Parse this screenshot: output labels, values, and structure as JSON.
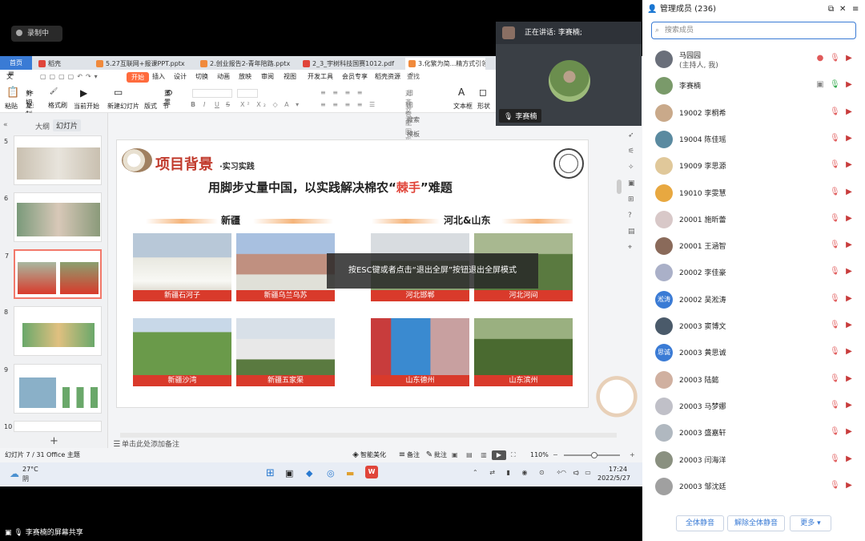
{
  "recording": {
    "label": "录制中"
  },
  "speaker": {
    "label": "正在讲话: 李赛楠;",
    "name": "李赛楠"
  },
  "wps": {
    "tabs": [
      {
        "label": "首页",
        "color": "#3a7bd5"
      },
      {
        "label": "稻壳",
        "color": "#e0453a"
      },
      {
        "label": "5.27互联网+报课PPT.pptx",
        "color": "#f08a3c"
      },
      {
        "label": "2.创业报告2-青年陪路.pptx",
        "color": "#f08a3c"
      },
      {
        "label": "2_3_宇树科技国赛1012.pdf",
        "color": "#e0453a"
      },
      {
        "label": "3.化繁为简...精方式引领者",
        "color": "#f08a3c"
      }
    ],
    "menu": [
      "文件",
      "开始",
      "插入",
      "设计",
      "切换",
      "动画",
      "放映",
      "审阅",
      "视图",
      "开发工具",
      "会员专享",
      "稻壳资源"
    ],
    "search_label": "查找命令、搜索模板",
    "ribbon": {
      "paste": "粘贴",
      "cut": "剪切",
      "copy": "复制",
      "format_painter": "格式刷",
      "from_current": "当前开始",
      "new_slide": "新建幻灯片",
      "layout": "版式",
      "section": "节",
      "reset": "重置",
      "align_text": "对齐文本",
      "convert_smartart": "转智能图形",
      "textbox": "文本框",
      "shape": "形状",
      "bold": "B",
      "italic": "I",
      "underline": "U",
      "strike": "S"
    },
    "left_tabs": [
      "大纲",
      "幻灯片"
    ],
    "thumb_numbers": [
      "5",
      "6",
      "7",
      "8",
      "9",
      "10"
    ],
    "add_slide": "+",
    "notes_placeholder": "单击此处添加备注",
    "status": {
      "slide_info": "幻灯片 7 / 31",
      "theme": "Office 主题",
      "beautify": "智能美化",
      "notes": "备注",
      "comments": "批注",
      "zoom": "110%"
    },
    "taskbar": {
      "temp": "27°C",
      "weather": "阴",
      "time": "17:24",
      "date": "2022/5/27"
    }
  },
  "slide": {
    "title": "项目背景",
    "subtitle": "·实习实践",
    "headline_pre": "用脚步丈量中国，以实践解决棉农“",
    "headline_hl": "棘手",
    "headline_post": "”难题",
    "region_left": "新疆",
    "region_right": "河北&山东",
    "photos": [
      "新疆石河子",
      "新疆乌兰乌苏",
      "河北邯郸",
      "河北河间",
      "新疆沙湾",
      "新疆五家渠",
      "山东德州",
      "山东滨州"
    ],
    "esc_message": "按ESC键或者点击“退出全屏”按钮退出全屏模式"
  },
  "members": {
    "title": "管理成员 (236)",
    "search_placeholder": "搜索成员",
    "list": [
      {
        "name": "马园园",
        "sub": "(主持人, 我)",
        "avatar": "#6a6f7a"
      },
      {
        "name": "李赛楠",
        "sub": "",
        "avatar": "#7a9a6a"
      },
      {
        "name": "19002 李桐希",
        "sub": "",
        "avatar": "#c9a98a"
      },
      {
        "name": "19004 陈佳瑶",
        "sub": "",
        "avatar": "#5a8aa0"
      },
      {
        "name": "19009 李思源",
        "sub": "",
        "avatar": "#e0c89a"
      },
      {
        "name": "19010 李雯慧",
        "sub": "",
        "avatar": "#e8a840"
      },
      {
        "name": "20001 施昕蕾",
        "sub": "",
        "avatar": "#d8c8c8"
      },
      {
        "name": "20001 王涵智",
        "sub": "",
        "avatar": "#8a6a5a"
      },
      {
        "name": "20002 李佳豪",
        "sub": "",
        "avatar": "#aab0c8"
      },
      {
        "name": "20002 吴淞涛",
        "sub": "",
        "avatar": "#3a7bd5",
        "initial": "淞涛"
      },
      {
        "name": "20003 窦博文",
        "sub": "",
        "avatar": "#4a5a6a"
      },
      {
        "name": "20003 黄思诚",
        "sub": "",
        "avatar": "#3a7bd5",
        "initial": "思诚"
      },
      {
        "name": "20003 陆懿",
        "sub": "",
        "avatar": "#d0b0a0"
      },
      {
        "name": "20003 马梦娜",
        "sub": "",
        "avatar": "#c0c0c8"
      },
      {
        "name": "20003 盛嘉轩",
        "sub": "",
        "avatar": "#b0b8c0"
      },
      {
        "name": "20003 闫海洋",
        "sub": "",
        "avatar": "#8a9080"
      },
      {
        "name": "20003 邹沈廷",
        "sub": "",
        "avatar": "#a0a0a0"
      }
    ],
    "mute_all": "全体静音",
    "unmute_all": "解除全体静音",
    "more": "更多"
  },
  "share_bar": {
    "label": "李赛楠的屏幕共享"
  }
}
